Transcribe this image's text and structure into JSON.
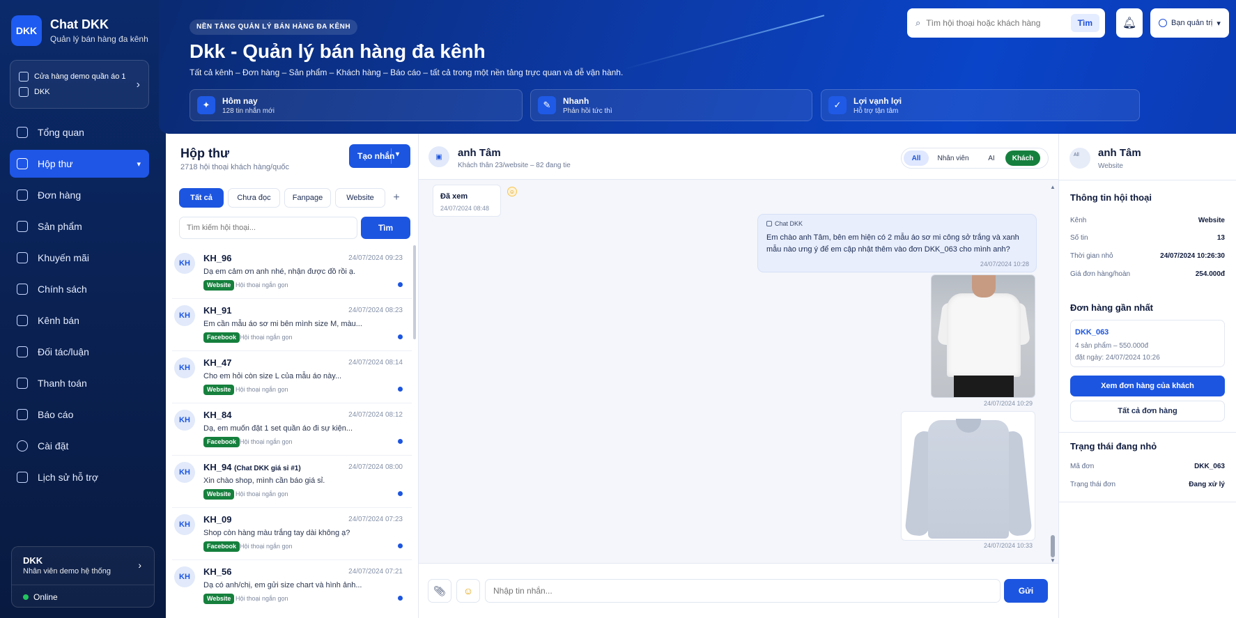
{
  "brand": {
    "logo": "DKK",
    "title": "Chat DKK",
    "subtitle": "Quản lý bán hàng đa kênh"
  },
  "store": {
    "name": "Cửa hàng demo quần áo 1",
    "code": "DKK"
  },
  "nav": [
    {
      "label": "Tổng quan",
      "icon": "home-icon"
    },
    {
      "label": "Hộp thư",
      "icon": "inbox-icon",
      "active": true
    },
    {
      "label": "Đơn hàng",
      "icon": "order-icon"
    },
    {
      "label": "Sản phẩm",
      "icon": "product-icon"
    },
    {
      "label": "Khuyến mãi",
      "icon": "promo-icon"
    },
    {
      "label": "Chính sách",
      "icon": "policy-icon"
    },
    {
      "label": "Kênh bán",
      "icon": "channel-icon"
    },
    {
      "label": "Đối tác/luận",
      "icon": "partner-icon"
    },
    {
      "label": "Thanh toán",
      "icon": "payment-icon"
    },
    {
      "label": "Báo cáo",
      "icon": "report-icon"
    },
    {
      "label": "Cài đặt",
      "icon": "settings-icon"
    },
    {
      "label": "Lịch sử hỗ trợ",
      "icon": "history-icon"
    }
  ],
  "user": {
    "name": "DKK",
    "role": "Nhân viên demo hệ thống",
    "status": "Online"
  },
  "header": {
    "eyebrow": "NỀN TẢNG QUẢN LÝ BÁN HÀNG ĐA KÊNH",
    "title": "Dkk - Quản lý bán hàng đa kênh",
    "subtitle": "Tất cả kênh – Đơn hàng – Sản phẩm – Khách hàng – Báo cáo – tất cả trong một nền tảng trực quan và dễ vận hành.",
    "search_placeholder": "Tìm hội thoại hoặc khách hàng",
    "search_button": "Tìm",
    "admin_label": "Bạn quản trị",
    "stats": [
      {
        "title": "Hôm nay",
        "sub": "128 tin nhắn mới",
        "icon": "spark-icon"
      },
      {
        "title": "Nhanh",
        "sub": "Phản hồi tức thì",
        "icon": "pen-icon"
      },
      {
        "title": "Lợi vạnh lợi",
        "sub": "Hỗ trợ tận tâm",
        "icon": "check-icon"
      }
    ]
  },
  "inbox": {
    "title": "Hộp thư",
    "subtitle": "2718 hội thoại khách hàng/quốc",
    "new_button": "Tạo nhắn",
    "tabs": [
      "Tất cả",
      "Chưa đọc",
      "Fanpage",
      "Website"
    ],
    "search_placeholder": "Tìm kiếm hội thoại...",
    "search_button": "Tìm",
    "conversations": [
      {
        "avatar": "KH",
        "name": "KH_96",
        "tag": "",
        "time": "24/07/2024 09:23",
        "message": "Dạ em cảm ơn anh nhé, nhận được đồ rồi ạ.",
        "channel": "Website",
        "summary": "Hội thoại ngắn gọn"
      },
      {
        "avatar": "KH",
        "name": "KH_91",
        "tag": "",
        "time": "24/07/2024 08:23",
        "message": "Em cần mẫu áo sơ mi bên mình size M, màu...",
        "channel": "Facebook",
        "summary": "Hội thoại ngắn gọn"
      },
      {
        "avatar": "KH",
        "name": "KH_47",
        "tag": "",
        "time": "24/07/2024 08:14",
        "message": "Cho em hỏi còn size L của mẫu áo này...",
        "channel": "Website",
        "summary": "Hội thoại ngắn gọn"
      },
      {
        "avatar": "KH",
        "name": "KH_84",
        "tag": "",
        "time": "24/07/2024 08:12",
        "message": "Dạ, em muốn đặt 1 set quần áo đi sự kiện...",
        "channel": "Facebook",
        "summary": "Hội thoại ngắn gọn"
      },
      {
        "avatar": "KH",
        "name": "KH_94",
        "tag": "(Chat DKK giá sỉ #1)",
        "time": "24/07/2024 08:00",
        "message": "Xin chào shop, mình cần báo giá sỉ.",
        "channel": "Website",
        "summary": "Hội thoại ngắn gọn"
      },
      {
        "avatar": "KH",
        "name": "KH_09",
        "tag": "",
        "time": "24/07/2024 07:23",
        "message": "Shop còn hàng màu trắng tay dài không ạ?",
        "channel": "Facebook",
        "summary": "Hội thoại ngắn gọn"
      },
      {
        "avatar": "KH",
        "name": "KH_56",
        "tag": "",
        "time": "24/07/2024 07:21",
        "message": "Dạ có anh/chị, em gửi size chart và hình ảnh...",
        "channel": "Website",
        "summary": "Hội thoại ngắn gọn"
      }
    ]
  },
  "chat": {
    "name": "anh Tâm",
    "subtitle": "Khách thân 23/website – 82 đang tie",
    "filters": [
      "All",
      "Nhân viên",
      "AI",
      "Khách"
    ],
    "seen_label": "Đã xem",
    "seen_time": "24/07/2024 08:48",
    "message_sender": "Chat DKK",
    "message_text": "Em chào anh Tâm, bên em hiện có 2 mẫu áo sơ mi công sở trắng và xanh mẫu nào ưng ý để em cập nhật thêm vào đơn DKK_063 cho mình anh?",
    "message_time": "24/07/2024 10:28",
    "image1_time": "24/07/2024 10:29",
    "image2_time": "24/07/2024 10:33",
    "input_placeholder": "Nhập tin nhắn...",
    "send_button": "Gửi"
  },
  "customer": {
    "avatar_label": "All",
    "name": "anh Tâm",
    "channel": "Website",
    "info_title": "Thông tin hội thoại",
    "info": [
      {
        "key": "Kênh",
        "value": "Website"
      },
      {
        "key": "Số tin",
        "value": "13"
      },
      {
        "key": "Thời gian nhỏ",
        "value": "24/07/2024 10:26:30"
      },
      {
        "key": "Giá đơn hàng/hoàn",
        "value": "254.000đ"
      }
    ],
    "recent_title": "Đơn hàng gần nhất",
    "order_id": "DKK_063",
    "order_summary": "4 sản phẩm – 550.000đ",
    "order_date": "đặt ngày: 24/07/2024 10:26",
    "view_orders_button": "Xem đơn hàng của khách",
    "all_orders_button": "Tất cả đơn hàng",
    "status_title": "Trạng thái đang nhỏ",
    "status": [
      {
        "key": "Mã đơn",
        "value": "DKK_063"
      },
      {
        "key": "Trạng thái đơn",
        "value": "Đang xử lý"
      }
    ]
  }
}
